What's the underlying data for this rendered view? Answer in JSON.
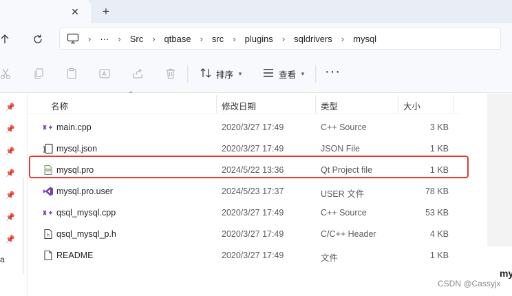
{
  "tabs": {
    "close_glyph": "✕",
    "new_tab_glyph": "+"
  },
  "nav": {
    "up_glyph": "↑",
    "refresh_glyph": "↻"
  },
  "breadcrumb": {
    "overflow": "···",
    "items": [
      "Src",
      "qtbase",
      "src",
      "plugins",
      "sqldrivers",
      "mysql"
    ]
  },
  "toolbar": {
    "sort_label": "排序",
    "view_label": "查看",
    "more_glyph": "···"
  },
  "columns": {
    "name": "名称",
    "date": "修改日期",
    "type": "类型",
    "size": "大小"
  },
  "files": [
    {
      "name": "main.cpp",
      "date": "2020/3/27 17:49",
      "type": "C++ Source",
      "size": "3 KB",
      "icon": "cpp-file-icon"
    },
    {
      "name": "mysql.json",
      "date": "2020/3/27 17:49",
      "type": "JSON File",
      "size": "1 KB",
      "icon": "json-file-icon"
    },
    {
      "name": "mysql.pro",
      "date": "2024/5/22 13:36",
      "type": "Qt Project file",
      "size": "1 KB",
      "icon": "qt-project-file-icon"
    },
    {
      "name": "mysql.pro.user",
      "date": "2024/5/23 17:37",
      "type": "USER 文件",
      "size": "78 KB",
      "icon": "visual-studio-file-icon"
    },
    {
      "name": "qsql_mysql.cpp",
      "date": "2020/3/27 17:49",
      "type": "C++ Source",
      "size": "53 KB",
      "icon": "cpp-file-icon"
    },
    {
      "name": "qsql_mysql_p.h",
      "date": "2020/3/27 17:49",
      "type": "C/C++ Header",
      "size": "4 KB",
      "icon": "header-file-icon"
    },
    {
      "name": "README",
      "date": "2020/3/27 17:49",
      "type": "文件",
      "size": "1 KB",
      "icon": "generic-file-icon"
    }
  ],
  "left_pane": {
    "truncated_text": "a"
  },
  "right_pane": {
    "truncated_text": "my"
  },
  "watermark": "CSDN @Cassyjx",
  "colors": {
    "highlight": "#e53935",
    "cpp_icon": "#7b3fb5"
  }
}
